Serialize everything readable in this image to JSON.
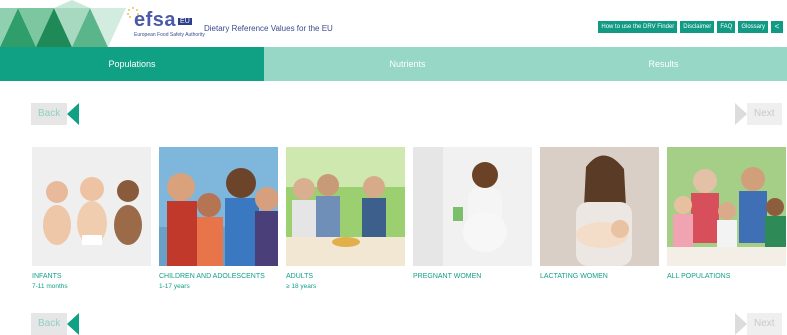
{
  "header": {
    "logo_text": "efsa",
    "logo_badge": "EU",
    "logo_subtitle": "European Food Safety Authority",
    "app_title": "Dietary Reference Values for the EU"
  },
  "topnav": [
    {
      "label": "How to use the DRV Finder"
    },
    {
      "label": "Disclaimer"
    },
    {
      "label": "FAQ"
    },
    {
      "label": "Glossary"
    }
  ],
  "share_icon": "share-icon",
  "steps": [
    {
      "label": "Populations",
      "active": true
    },
    {
      "label": "Nutrients",
      "active": false
    },
    {
      "label": "Results",
      "active": false
    }
  ],
  "nav": {
    "back": "Back",
    "next": "Next"
  },
  "populations": [
    {
      "label": "INFANTS",
      "sub": "7-11 months"
    },
    {
      "label": "CHILDREN AND ADOLESCENTS",
      "sub": "1-17 years"
    },
    {
      "label": "ADULTS",
      "sub": "≥ 18 years"
    },
    {
      "label": "PREGNANT WOMEN",
      "sub": ""
    },
    {
      "label": "LACTATING WOMEN",
      "sub": ""
    },
    {
      "label": "ALL POPULATIONS",
      "sub": ""
    }
  ],
  "colors": {
    "primary": "#10a084",
    "light": "#96d7c6",
    "navy": "#3b4b8f"
  }
}
